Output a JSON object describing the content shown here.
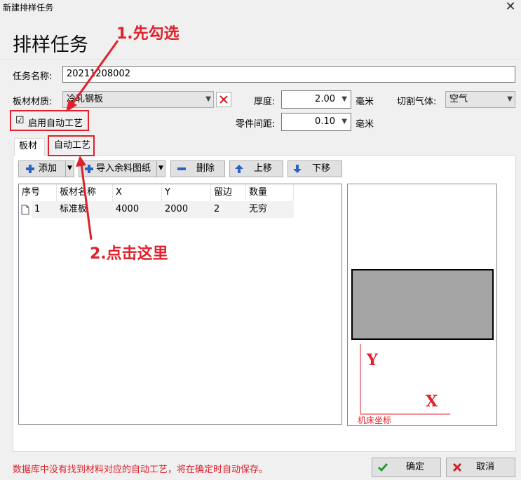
{
  "window": {
    "title": "新建排样任务",
    "close_glyph": "✕"
  },
  "header": {
    "title": "排样任务"
  },
  "form": {
    "task_name_label": "任务名称:",
    "task_name_value": "20211208002",
    "material_label": "板材材质:",
    "material_value": "冷轧钢板",
    "thickness_label": "厚度:",
    "thickness_value": "2.00",
    "thickness_unit": "毫米",
    "gas_label": "切割气体:",
    "gas_value": "空气",
    "auto_process_label": "启用自动工艺",
    "auto_process_checked_glyph": "☑",
    "spacing_label": "零件间距:",
    "spacing_value": "0.10",
    "spacing_unit": "毫米"
  },
  "tabs": [
    {
      "label": "板材"
    },
    {
      "label": "自动工艺"
    }
  ],
  "toolbar": {
    "add_label": "添加",
    "import_label": "导入余料图纸",
    "delete_label": "删除",
    "up_label": "上移",
    "down_label": "下移"
  },
  "table": {
    "columns": [
      "序号",
      "板材名称",
      "X",
      "Y",
      "留边",
      "数量"
    ],
    "rows": [
      {
        "index": "1",
        "name": "标准板",
        "x": "4000",
        "y": "2000",
        "margin": "2",
        "qty": "无穷"
      }
    ]
  },
  "preview": {
    "axis_y": "Y",
    "axis_x": "X",
    "caption": "机床坐标"
  },
  "annotations": {
    "step1": "1.先勾选",
    "step2": "2.点击这里"
  },
  "footer": {
    "note": "数据库中没有找到材料对应的自动工艺，将在确定时自动保存。",
    "ok_label": "确定",
    "cancel_label": "取消"
  },
  "colors": {
    "accent_red": "#e0202a",
    "icon_blue": "#2a63c8",
    "ok_green": "#1f9d3a",
    "sheet_gray": "#a5a5a6"
  }
}
